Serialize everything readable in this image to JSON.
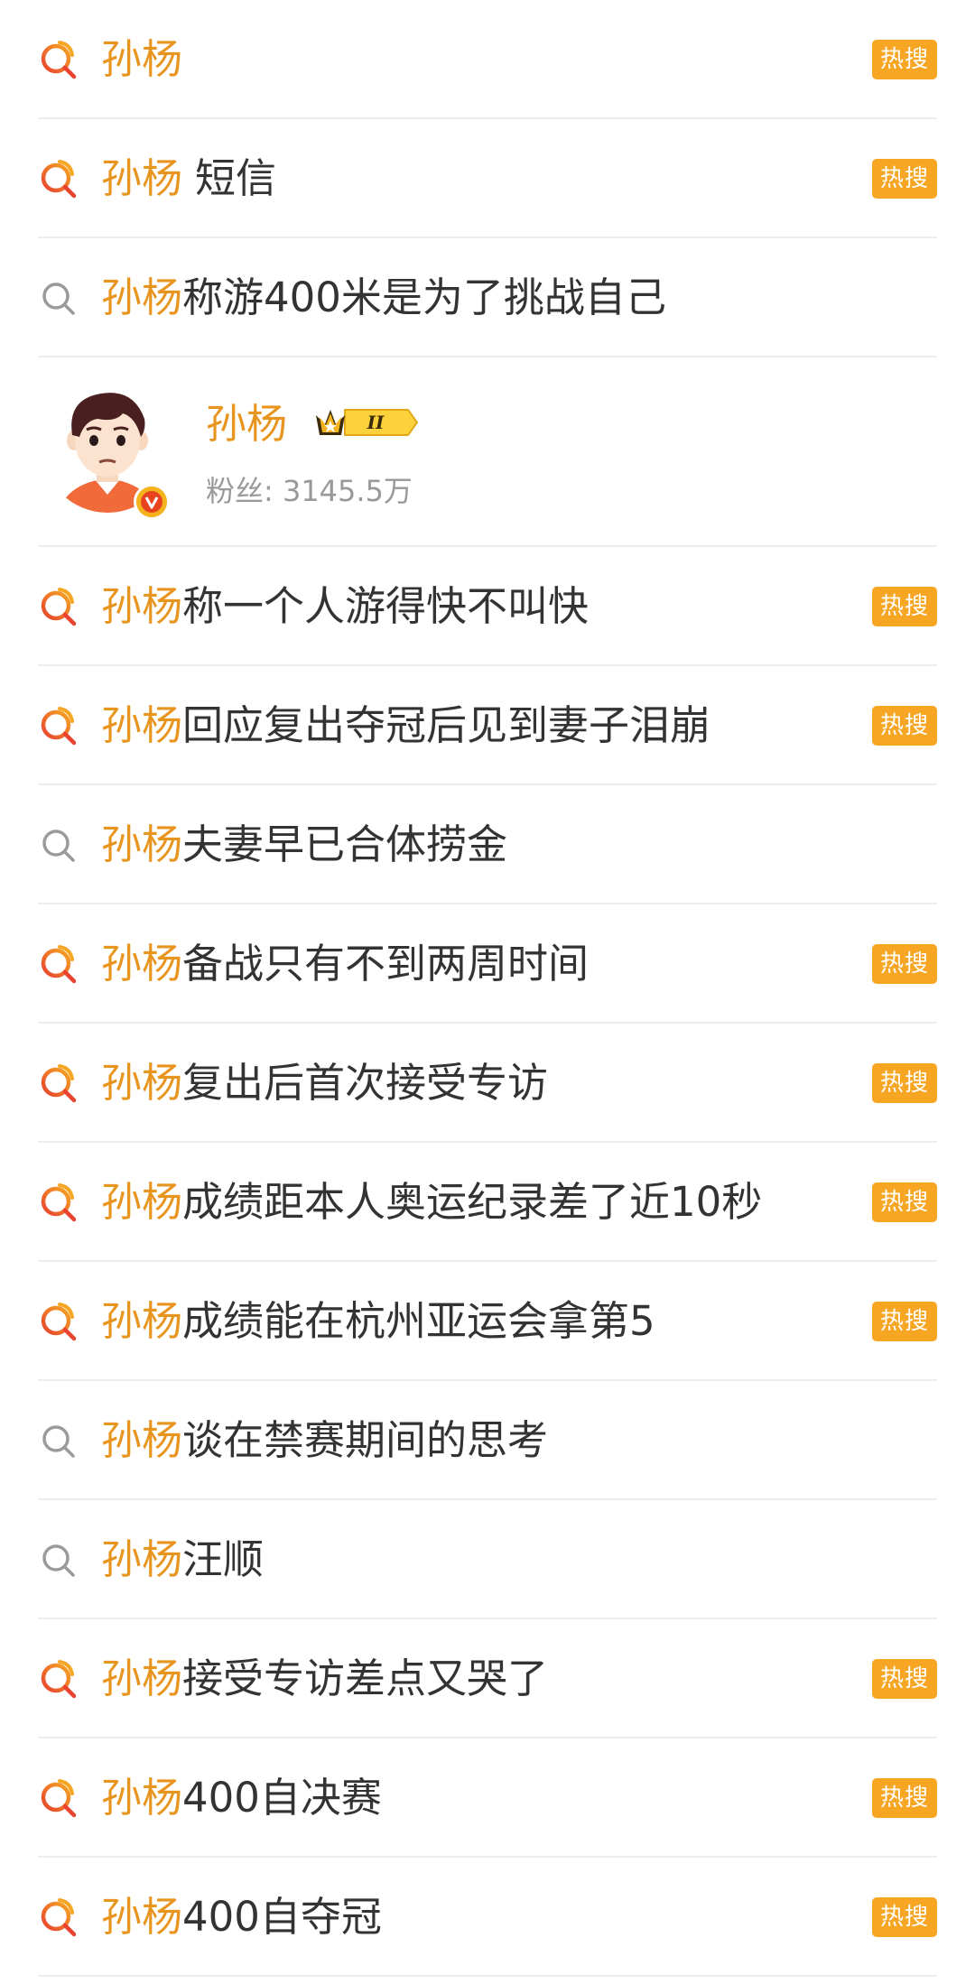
{
  "highlight": "孙杨",
  "hot_label": "热搜",
  "rows_top": [
    {
      "suffix": "",
      "hot": true
    },
    {
      "suffix": "短信",
      "hot": true,
      "spaced": true
    },
    {
      "suffix": "称游400米是为了挑战自己",
      "hot": false
    }
  ],
  "user_card": {
    "name": "孙杨",
    "level": "II",
    "fans": "粉丝: 3145.5万"
  },
  "rows_bottom": [
    {
      "suffix": "称一个人游得快不叫快",
      "hot": true
    },
    {
      "suffix": "回应复出夺冠后见到妻子泪崩",
      "hot": true
    },
    {
      "suffix": "夫妻早已合体捞金",
      "hot": false
    },
    {
      "suffix": "备战只有不到两周时间",
      "hot": true
    },
    {
      "suffix": "复出后首次接受专访",
      "hot": true
    },
    {
      "suffix": "成绩距本人奥运纪录差了近10秒",
      "hot": true
    },
    {
      "suffix": "成绩能在杭州亚运会拿第5",
      "hot": true
    },
    {
      "suffix": "谈在禁赛期间的思考",
      "hot": false
    },
    {
      "suffix": "汪顺",
      "hot": false
    },
    {
      "suffix": "接受专访差点又哭了",
      "hot": true
    },
    {
      "suffix": "400自决赛",
      "hot": true
    },
    {
      "suffix": "400自夺冠",
      "hot": true
    }
  ],
  "colors": {
    "highlight": "#e8951f",
    "badge": "#f6a623",
    "hot_icon_gradient": [
      "#e8432f",
      "#f6a623"
    ],
    "plain_icon": "#9a9a9a"
  }
}
